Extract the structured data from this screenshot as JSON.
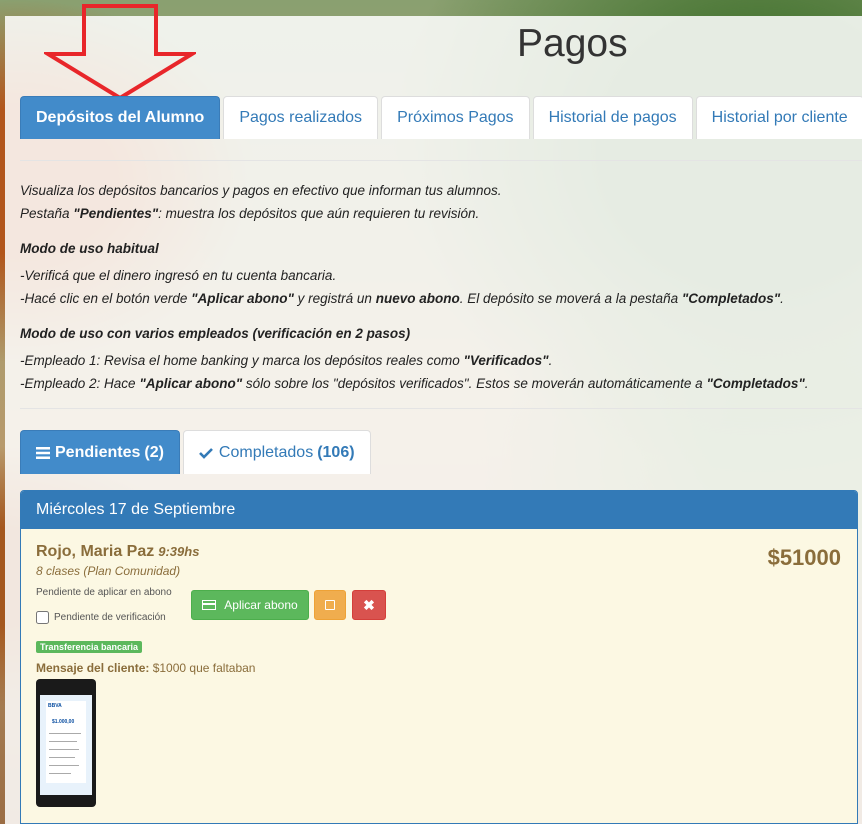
{
  "page": {
    "title": "Pagos"
  },
  "tabs": [
    {
      "label": "Depósitos del Alumno",
      "active": true
    },
    {
      "label": "Pagos realizados",
      "active": false
    },
    {
      "label": "Próximos Pagos",
      "active": false
    },
    {
      "label": "Historial de pagos",
      "active": false
    },
    {
      "label": "Historial por cliente",
      "active": false
    }
  ],
  "info": {
    "line1": "Visualiza los depósitos bancarios y pagos en efectivo que informan tus alumnos.",
    "line2_pre": "Pestaña ",
    "line2_bold": "\"Pendientes\"",
    "line2_post": ": muestra los depósitos que aún requieren tu revisión.",
    "heading1": "Modo de uso habitual",
    "step1": "-Verificá que el dinero ingresó en tu cuenta bancaria.",
    "step2_a": "-Hacé clic en el botón verde ",
    "step2_b": "\"Aplicar abono\"",
    "step2_c": " y registrá un ",
    "step2_d": "nuevo abono",
    "step2_e": ". El depósito se moverá a la pestaña ",
    "step2_f": "\"Completados\"",
    "step2_g": ".",
    "heading2": "Modo de uso con varios empleados (verificación en 2 pasos)",
    "emp1_a": "-Empleado 1: Revisa el home banking y marca los depósitos reales como ",
    "emp1_b": "\"Verificados\"",
    "emp1_c": ".",
    "emp2_a": "-Empleado 2: Hace ",
    "emp2_b": "\"Aplicar abono\"",
    "emp2_c": " sólo sobre los \"depósitos verificados\". Estos se moverán automáticamente a ",
    "emp2_d": "\"Completados\"",
    "emp2_e": "."
  },
  "subtabs": {
    "pendientes_label": "Pendientes",
    "pendientes_count": "(2)",
    "completados_label": "Completados",
    "completados_count": "(106)"
  },
  "deposit": {
    "date": "Miércoles 17 de Septiembre",
    "name": "Rojo, Maria Paz",
    "time": "9:39hs",
    "plan": "8 clases (Plan Comunidad)",
    "amount": "$51000",
    "status": "Pendiente de aplicar en abono",
    "verification_label": "Pendiente de verificación",
    "apply_label": "Aplicar abono",
    "method": "Transferencia bancaria",
    "message_label": "Mensaje del cliente:",
    "message": " $1000 que faltaban",
    "receipt_bank": "BBVA",
    "receipt_amount": "$1.000,00"
  }
}
